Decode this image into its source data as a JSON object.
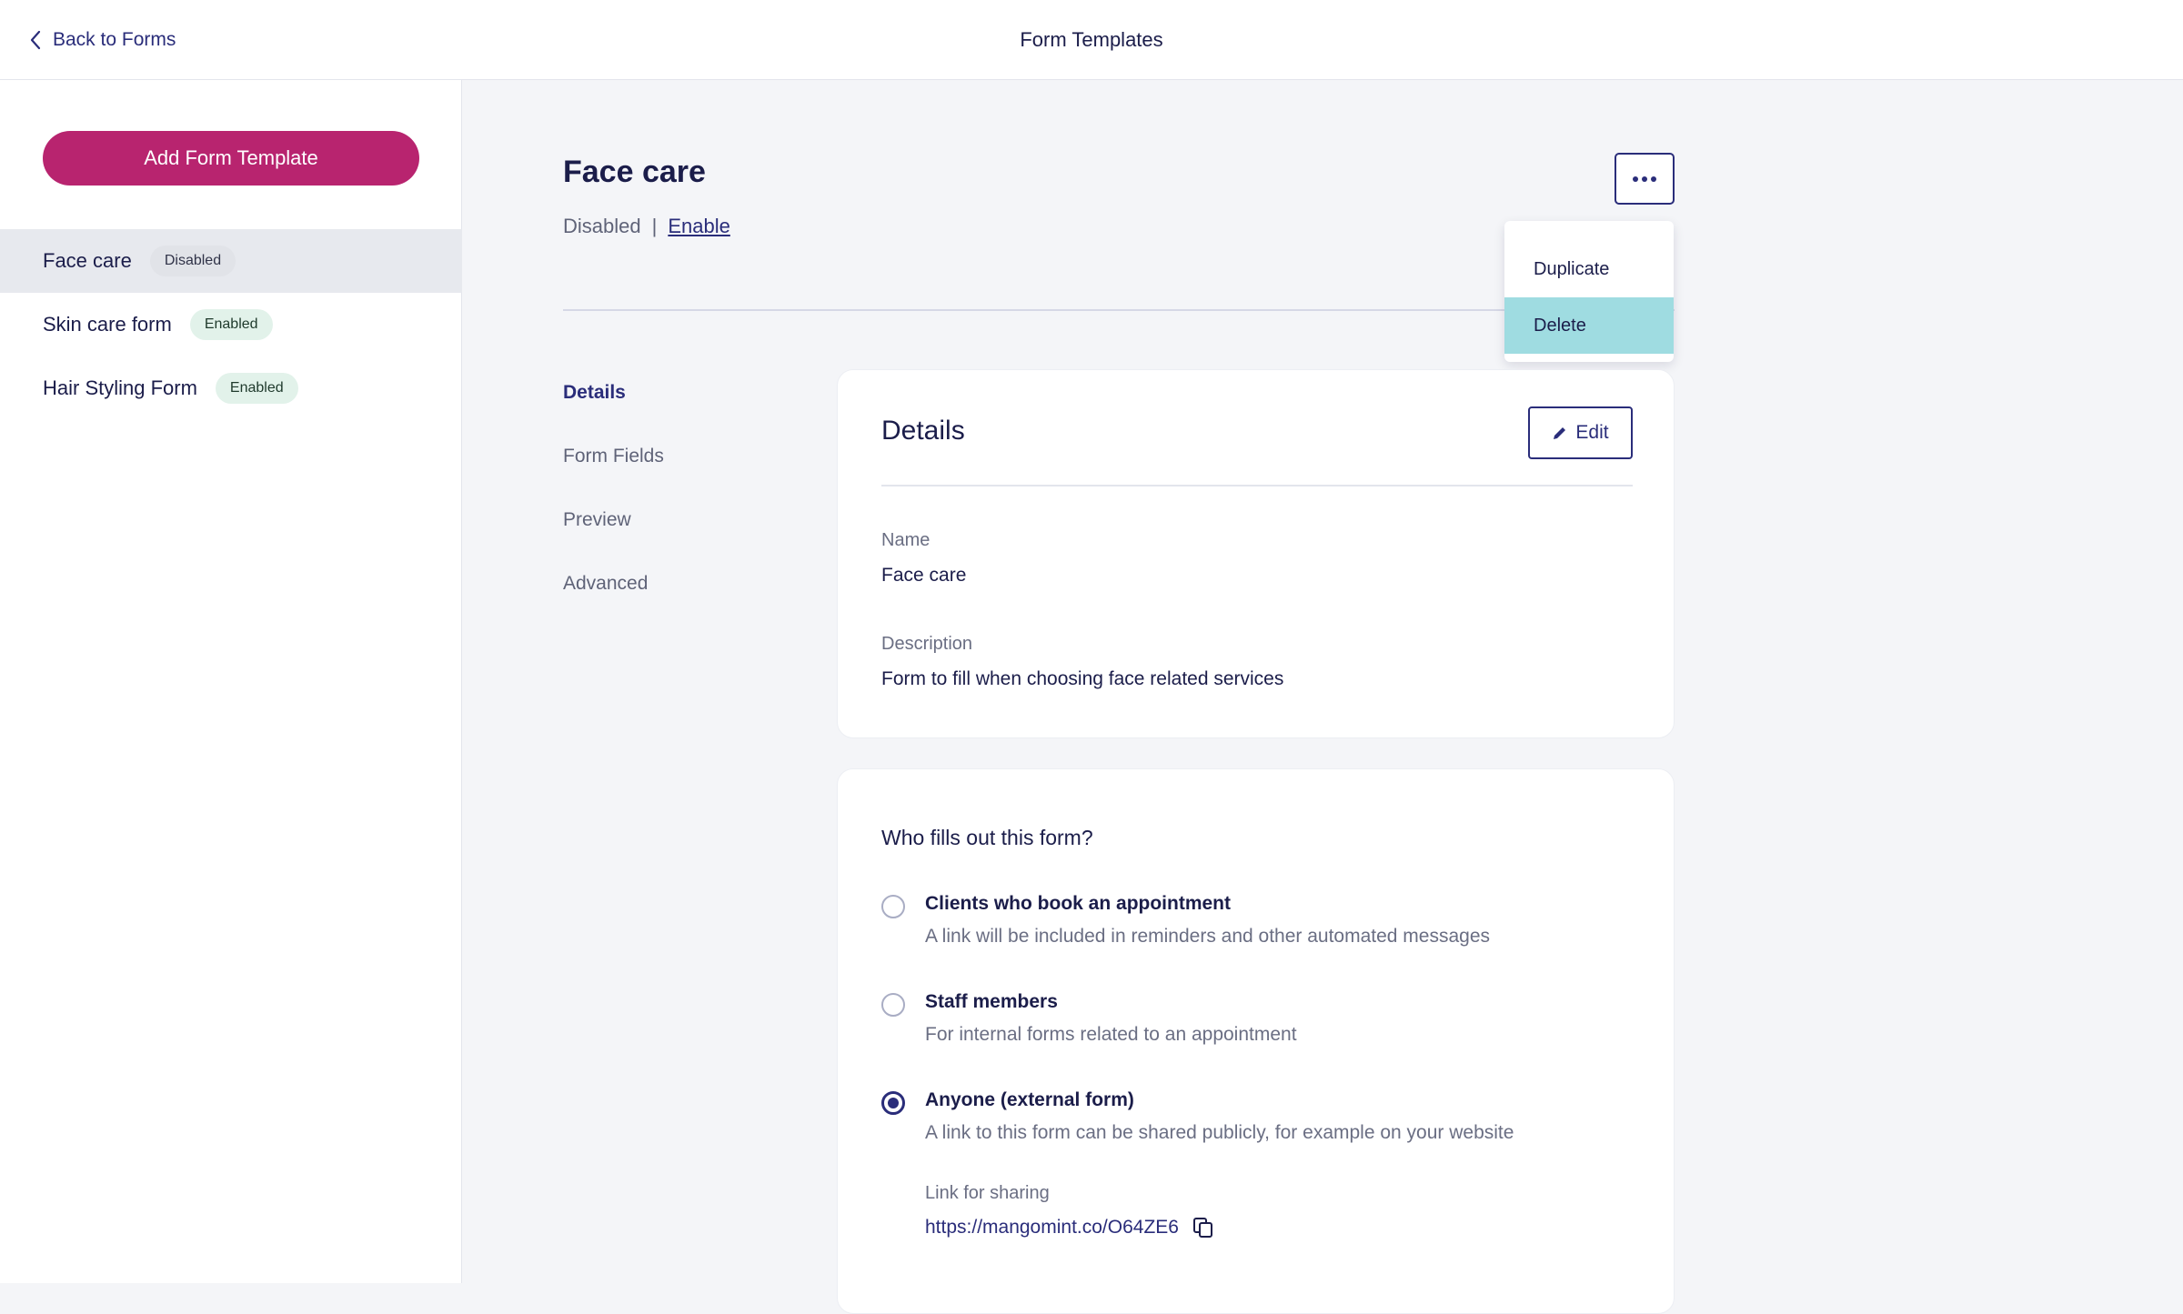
{
  "header": {
    "back_label": "Back to Forms",
    "title": "Form Templates"
  },
  "sidebar": {
    "add_button": "Add Form Template",
    "items": [
      {
        "name": "Face care",
        "status": "Disabled",
        "active": true
      },
      {
        "name": "Skin care form",
        "status": "Enabled",
        "active": false
      },
      {
        "name": "Hair Styling Form",
        "status": "Enabled",
        "active": false
      }
    ]
  },
  "form": {
    "title": "Face care",
    "status": "Disabled",
    "separator": "|",
    "enable_link": "Enable"
  },
  "menu": {
    "items": [
      "Duplicate",
      "Delete"
    ],
    "highlighted": "Delete"
  },
  "section_nav": [
    "Details",
    "Form Fields",
    "Preview",
    "Advanced"
  ],
  "details_card": {
    "title": "Details",
    "edit_label": "Edit",
    "name_label": "Name",
    "name_value": "Face care",
    "description_label": "Description",
    "description_value": "Form to fill when choosing face related services"
  },
  "audience_card": {
    "question": "Who fills out this form?",
    "options": [
      {
        "label": "Clients who book an appointment",
        "desc": "A link will be included in reminders and other automated messages",
        "checked": false
      },
      {
        "label": "Staff members",
        "desc": "For internal forms related to an appointment",
        "checked": false
      },
      {
        "label": "Anyone (external form)",
        "desc": "A link to this form can be shared publicly, for example on your website",
        "checked": true
      }
    ],
    "share_label": "Link for sharing",
    "share_url": "https://mangomint.co/O64ZE6"
  },
  "colors": {
    "accent": "#b8246f",
    "primary": "#2a2d7a",
    "menu_highlight": "#9fdce1"
  }
}
